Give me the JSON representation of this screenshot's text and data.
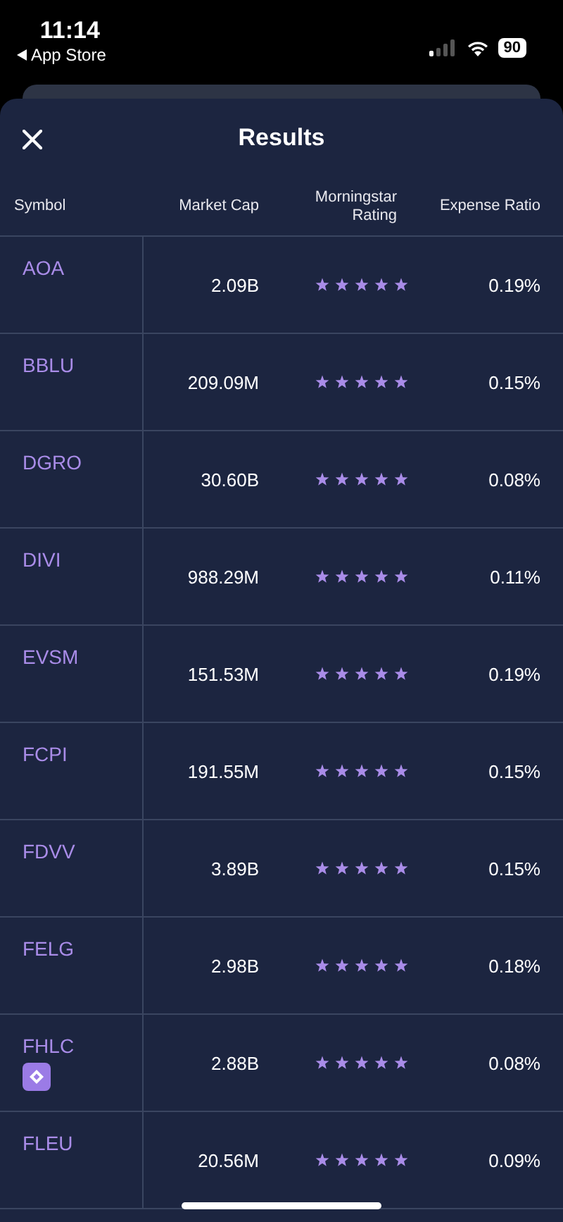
{
  "status_bar": {
    "time": "11:14",
    "back_label": "App Store",
    "battery": "90"
  },
  "sheet": {
    "title": "Results"
  },
  "table": {
    "columns": [
      "Symbol",
      "Market Cap",
      "Morningstar Rating",
      "Expense Ratio"
    ],
    "rows": [
      {
        "symbol": "AOA",
        "market_cap": "2.09B",
        "stars": 5,
        "expense_ratio": "0.19%",
        "badge": false
      },
      {
        "symbol": "BBLU",
        "market_cap": "209.09M",
        "stars": 5,
        "expense_ratio": "0.15%",
        "badge": false
      },
      {
        "symbol": "DGRO",
        "market_cap": "30.60B",
        "stars": 5,
        "expense_ratio": "0.08%",
        "badge": false
      },
      {
        "symbol": "DIVI",
        "market_cap": "988.29M",
        "stars": 5,
        "expense_ratio": "0.11%",
        "badge": false
      },
      {
        "symbol": "EVSM",
        "market_cap": "151.53M",
        "stars": 5,
        "expense_ratio": "0.19%",
        "badge": false
      },
      {
        "symbol": "FCPI",
        "market_cap": "191.55M",
        "stars": 5,
        "expense_ratio": "0.15%",
        "badge": false
      },
      {
        "symbol": "FDVV",
        "market_cap": "3.89B",
        "stars": 5,
        "expense_ratio": "0.15%",
        "badge": false
      },
      {
        "symbol": "FELG",
        "market_cap": "2.98B",
        "stars": 5,
        "expense_ratio": "0.18%",
        "badge": false
      },
      {
        "symbol": "FHLC",
        "market_cap": "2.88B",
        "stars": 5,
        "expense_ratio": "0.08%",
        "badge": true
      },
      {
        "symbol": "FLEU",
        "market_cap": "20.56M",
        "stars": 5,
        "expense_ratio": "0.09%",
        "badge": false
      }
    ]
  }
}
